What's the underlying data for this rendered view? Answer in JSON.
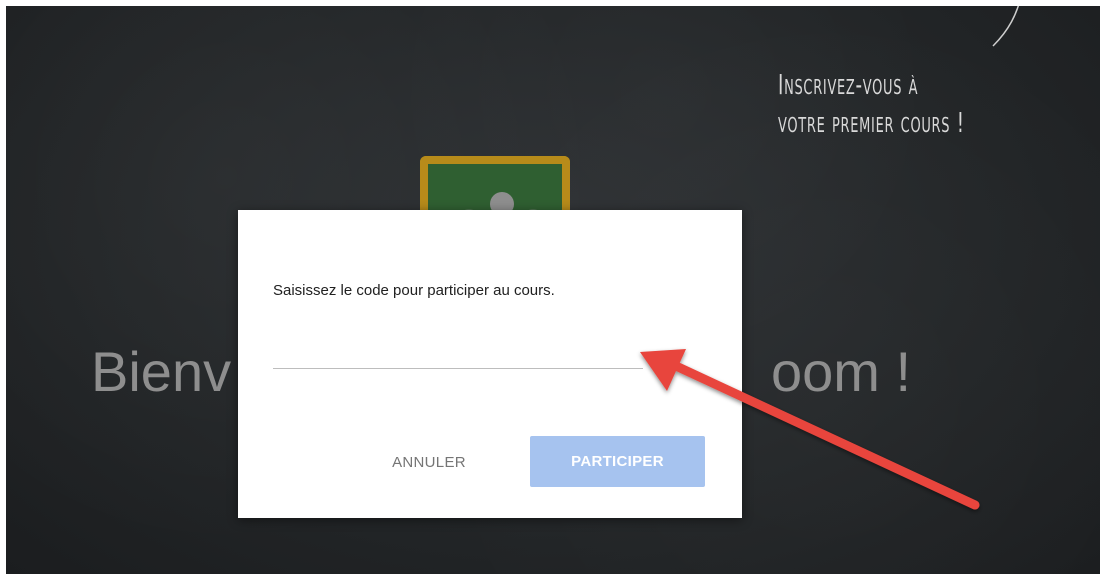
{
  "background": {
    "promo_line1": "Inscrivez-vous à",
    "promo_line2": "votre premier cours !",
    "welcome_left": "Bienv",
    "welcome_right": "oom !",
    "colors": {
      "chalkboard": "#232628",
      "board_frame": "#b78b1a",
      "board_green": "#2f5f31"
    },
    "icons": [
      "classroom-board-icon",
      "chalk-stroke-icon"
    ]
  },
  "dialog": {
    "prompt": "Saisissez le code pour participer au cours.",
    "code_value": "",
    "cancel_label": "ANNULER",
    "join_label": "PARTICIPER",
    "colors": {
      "join_button": "#a6c3ef",
      "annotation_arrow": "#e8453c"
    }
  }
}
